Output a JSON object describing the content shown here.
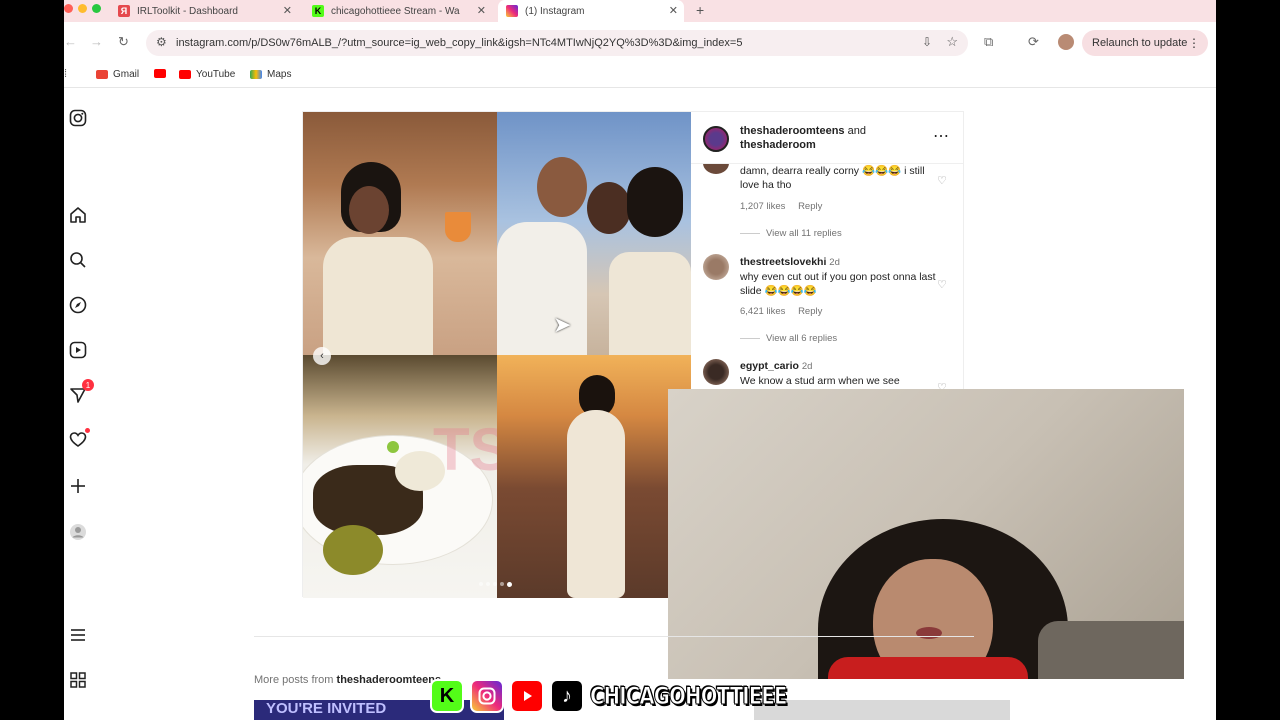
{
  "browser": {
    "tabs": [
      {
        "title": "IRLToolkit - Dashboard",
        "favicon": "irltoolkit-icon",
        "active": false
      },
      {
        "title": "chicagohottieee Stream - Wa",
        "favicon": "kick-icon",
        "active": false
      },
      {
        "title": "(1) Instagram",
        "favicon": "instagram-icon",
        "active": true
      }
    ],
    "new_tab": "+",
    "url": "instagram.com/p/DS0w76mALB_/?utm_source=ig_web_copy_link&igsh=NTc4MTIwNjQ2YQ%3D%3D&img_index=5",
    "relaunch_label": "Relaunch to update",
    "bookmarks": [
      {
        "label": "Gmail",
        "icon": "gmail-icon",
        "color": "#ea4335"
      },
      {
        "label": "",
        "icon": "youtube-icon",
        "color": "#ff0000"
      },
      {
        "label": "YouTube",
        "icon": "youtube-icon",
        "color": "#ff0000"
      },
      {
        "label": "Maps",
        "icon": "maps-icon",
        "color": "#34a853"
      }
    ]
  },
  "sidebar": {
    "notifications_badge": "1"
  },
  "post": {
    "header": {
      "author": "theshaderoomteens",
      "joiner": " and ",
      "coauthor": "theshaderoom",
      "more_icon": "⋯"
    },
    "comments": [
      {
        "user": "",
        "text": "damn, dearra really corny 😂😂😂 i still love ha tho",
        "likes": "1,207 likes",
        "reply": "Reply",
        "view_replies": "View all 11 replies"
      },
      {
        "user": "thestreetslovekhi",
        "age": "2d",
        "text": "why even cut out if you gon post onna last slide 😂😂😂😂",
        "likes": "6,421 likes",
        "reply": "Reply",
        "view_replies": "View all 6 replies"
      },
      {
        "user": "egypt_cario",
        "age": "2d",
        "text": "We know a stud arm when we see"
      }
    ],
    "watermark": "TSR"
  },
  "more_posts": {
    "prefix": "More posts from ",
    "account": "theshaderoomteens",
    "thumb_text": "YOU'RE INVITED"
  },
  "overlay": {
    "handle": "CHICAGOHOTTIEEE",
    "socials": [
      "kick-icon",
      "instagram-icon",
      "youtube-icon",
      "tiktok-icon"
    ],
    "kick_letter": "K"
  },
  "colors": {
    "tabstrip": "#f9e1e4",
    "instagram_badge": "#ff3040",
    "kick_green": "#53fc18"
  }
}
